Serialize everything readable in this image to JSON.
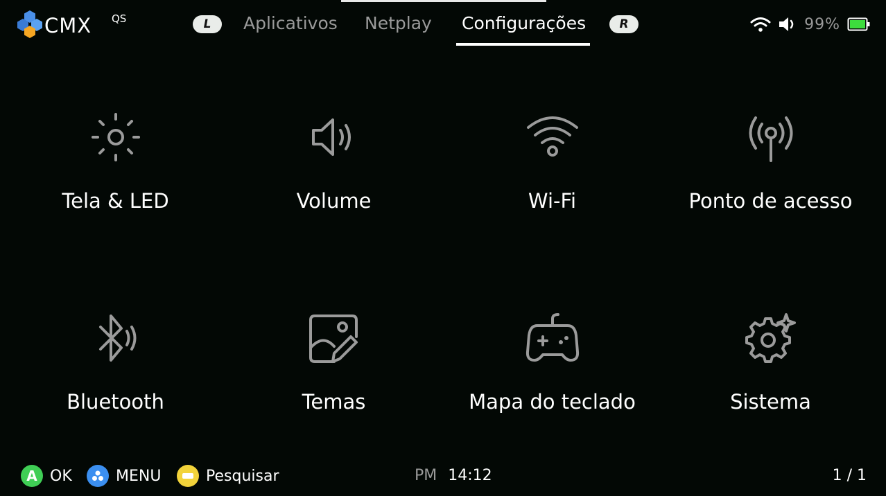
{
  "header": {
    "logo_text": "CMX",
    "logo_sup": "QS",
    "left_shoulder": "L",
    "right_shoulder": "R",
    "tabs": [
      {
        "label": "Aplicativos",
        "active": false
      },
      {
        "label": "Netplay",
        "active": false
      },
      {
        "label": "Configurações",
        "active": true
      }
    ],
    "status": {
      "wifi_icon": "wifi-icon",
      "volume_icon": "speaker-icon",
      "battery_percent": "99%",
      "battery_color": "#3ddc3d"
    }
  },
  "grid": [
    {
      "label": "Tela & LED",
      "icon": "brightness-icon"
    },
    {
      "label": "Volume",
      "icon": "speaker-icon"
    },
    {
      "label": "Wi-Fi",
      "icon": "wifi-icon"
    },
    {
      "label": "Ponto de acesso",
      "icon": "hotspot-icon"
    },
    {
      "label": "Bluetooth",
      "icon": "bluetooth-icon"
    },
    {
      "label": "Temas",
      "icon": "theme-icon"
    },
    {
      "label": "Mapa do teclado",
      "icon": "gamepad-icon"
    },
    {
      "label": "Sistema",
      "icon": "system-gear-icon"
    }
  ],
  "footer": {
    "a_button": {
      "glyph": "A",
      "label": "OK",
      "color": "#3fce55"
    },
    "menu_button": {
      "label": "MENU",
      "color": "#3b8ff0"
    },
    "search_button": {
      "label": "Pesquisar",
      "color": "#f2d33a"
    },
    "time_period": "PM",
    "time": "14:12",
    "pager": "1 / 1"
  },
  "colors": {
    "background": "#030805",
    "icon_gray": "#9b9b9b",
    "inactive_text": "#9a9a9a"
  }
}
